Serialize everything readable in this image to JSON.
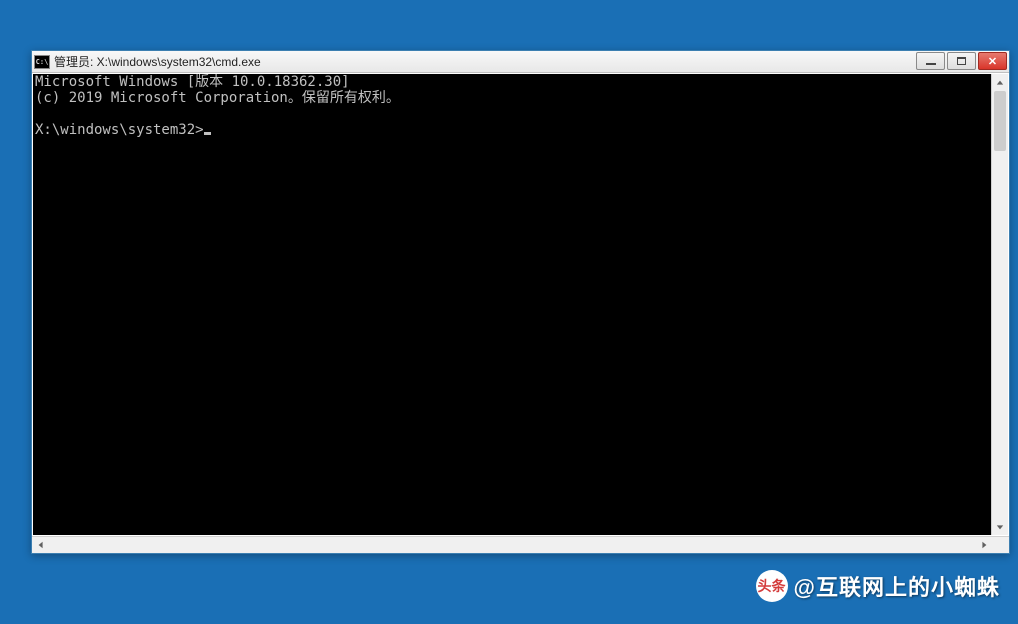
{
  "window": {
    "title": "管理员: X:\\windows\\system32\\cmd.exe",
    "icon_label": "C:\\"
  },
  "console": {
    "line1": "Microsoft Windows [版本 10.0.18362.30]",
    "line2": "(c) 2019 Microsoft Corporation。保留所有权利。",
    "blank": "",
    "prompt": "X:\\windows\\system32>"
  },
  "watermark": {
    "logo_text": "头条",
    "text": "@互联网上的小蜘蛛"
  }
}
